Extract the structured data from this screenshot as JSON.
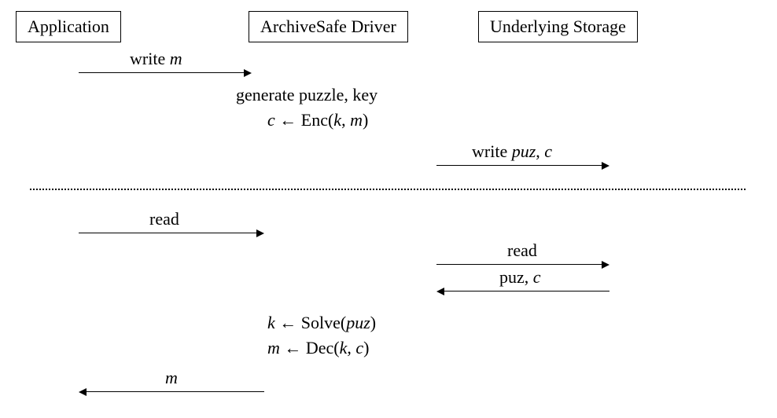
{
  "boxes": {
    "application": "Application",
    "driver": "ArchiveSafe Driver",
    "storage": "Underlying Storage"
  },
  "write_flow": {
    "arrow1_label_prefix": "write ",
    "arrow1_label_var": "m",
    "step1": "generate puzzle, key",
    "step2_pre": "c",
    "step2_arrow": " ← Enc(",
    "step2_k": "k",
    "step2_comma": ", ",
    "step2_m": "m",
    "step2_close": ")",
    "arrow2_label_prefix": "write ",
    "arrow2_label_puz": "puz",
    "arrow2_label_comma": ", ",
    "arrow2_label_c": "c"
  },
  "read_flow": {
    "arrow1_label": "read",
    "arrow2_label": "read",
    "arrow3_label_puz": "puz, ",
    "arrow3_label_c": "c",
    "step1_k": "k",
    "step1_arrow": " ← Solve(",
    "step1_puz": "puz",
    "step1_close": ")",
    "step2_m": "m",
    "step2_arrow": " ← Dec(",
    "step2_k": "k",
    "step2_comma": ", ",
    "step2_c": "c",
    "step2_close": ")",
    "arrow4_label": "m"
  }
}
